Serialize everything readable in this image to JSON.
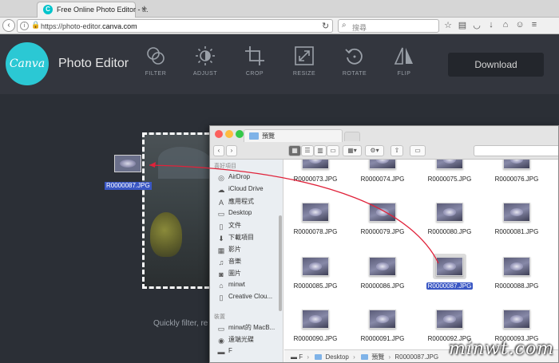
{
  "browser": {
    "tab_title": "Free Online Photo Editor - ...",
    "url_prefix": "https://photo-editor.",
    "url_domain": "canva.com",
    "search_placeholder": "搜尋"
  },
  "app": {
    "logo_text": "Canva",
    "title": "Photo Editor",
    "tools": [
      {
        "label": "FILTER",
        "icon": "filter-icon"
      },
      {
        "label": "ADJUST",
        "icon": "adjust-icon"
      },
      {
        "label": "CROP",
        "icon": "crop-icon"
      },
      {
        "label": "RESIZE",
        "icon": "resize-icon"
      },
      {
        "label": "ROTATE",
        "icon": "rotate-icon"
      },
      {
        "label": "FLIP",
        "icon": "flip-icon"
      }
    ],
    "download_label": "Download"
  },
  "canvas": {
    "hint_text": "Quickly filter, re",
    "drag_file_label": "R0000087.JPG"
  },
  "finder": {
    "tab_label": "預覽",
    "sidebar": {
      "favorites_header": "喜好項目",
      "favorites": [
        {
          "label": "AirDrop",
          "icon": "airdrop-icon"
        },
        {
          "label": "iCloud Drive",
          "icon": "cloud-icon"
        },
        {
          "label": "應用程式",
          "icon": "applications-icon"
        },
        {
          "label": "Desktop",
          "icon": "desktop-icon"
        },
        {
          "label": "文件",
          "icon": "document-icon"
        },
        {
          "label": "下載項目",
          "icon": "download-icon"
        },
        {
          "label": "影片",
          "icon": "movie-icon"
        },
        {
          "label": "音樂",
          "icon": "music-icon"
        },
        {
          "label": "圖片",
          "icon": "camera-icon"
        },
        {
          "label": "minwt",
          "icon": "home-icon"
        },
        {
          "label": "Creative Clou...",
          "icon": "creative-cloud-icon"
        }
      ],
      "devices_header": "裝置",
      "devices": [
        {
          "label": "minwt的 MacB...",
          "icon": "laptop-icon"
        },
        {
          "label": "遠端光碟",
          "icon": "disc-icon"
        },
        {
          "label": "F",
          "icon": "drive-icon"
        }
      ]
    },
    "files": [
      "R0000073.JPG",
      "R0000074.JPG",
      "R0000075.JPG",
      "R0000076.JPG",
      "R0000078.JPG",
      "R0000079.JPG",
      "R0000080.JPG",
      "R0000081.JPG",
      "R0000085.JPG",
      "R0000086.JPG",
      "R0000087.JPG",
      "R0000088.JPG",
      "R0000090.JPG",
      "R0000091.JPG",
      "R0000092.JPG",
      "R0000093.JPG"
    ],
    "selected_file": "R0000087.JPG",
    "path": {
      "drive": "F",
      "desktop": "Desktop",
      "folder": "預覽",
      "file": "R0000087.JPG"
    }
  },
  "watermark": "minwt.com",
  "colors": {
    "canva_teal": "#2bc8d4",
    "toolbar_bg": "#33363e",
    "selection_blue": "#3a57c4",
    "drag_line": "#e0223a"
  }
}
